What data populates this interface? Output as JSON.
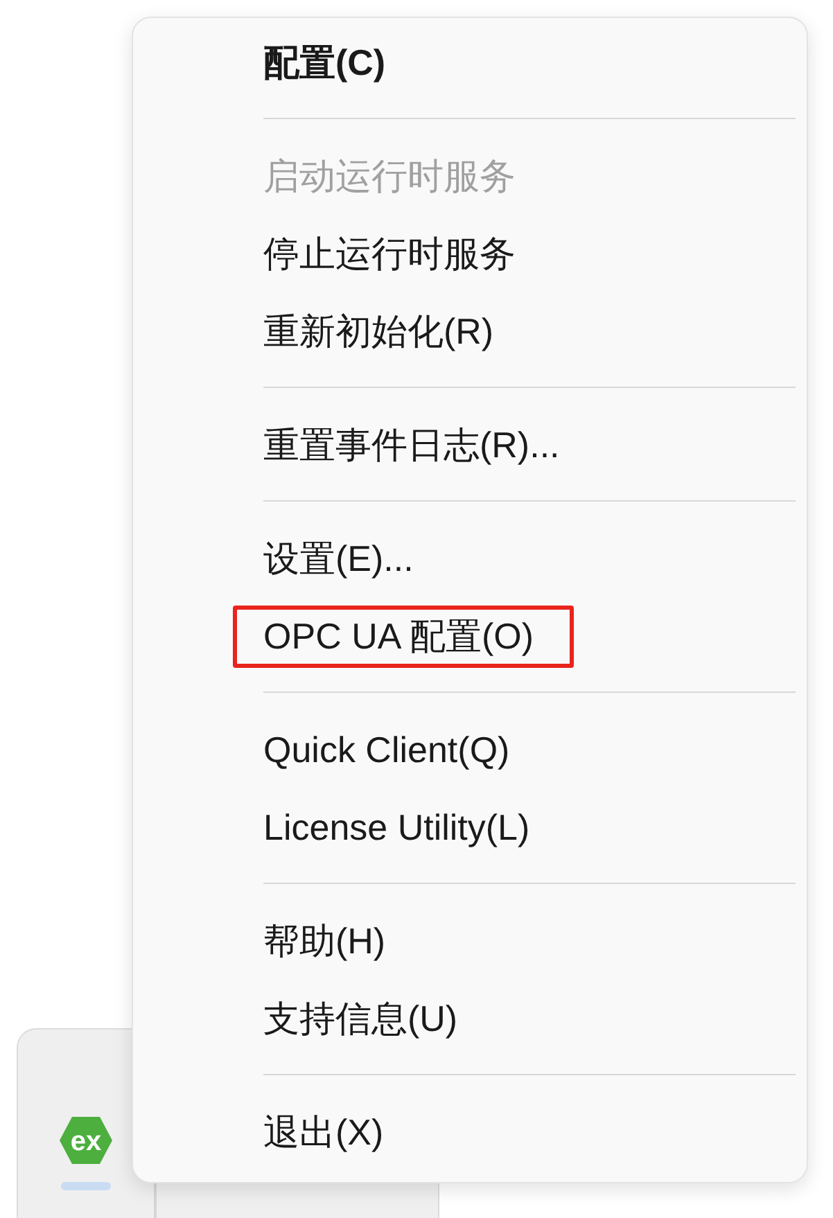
{
  "menu": {
    "groups": [
      [
        {
          "label": "配置(C)",
          "default": true,
          "disabled": false,
          "highlighted": false
        }
      ],
      [
        {
          "label": "启动运行时服务",
          "default": false,
          "disabled": true,
          "highlighted": false
        },
        {
          "label": "停止运行时服务",
          "default": false,
          "disabled": false,
          "highlighted": false
        },
        {
          "label": "重新初始化(R)",
          "default": false,
          "disabled": false,
          "highlighted": false
        }
      ],
      [
        {
          "label": "重置事件日志(R)...",
          "default": false,
          "disabled": false,
          "highlighted": false
        }
      ],
      [
        {
          "label": "设置(E)...",
          "default": false,
          "disabled": false,
          "highlighted": false
        },
        {
          "label": "OPC UA 配置(O)",
          "default": false,
          "disabled": false,
          "highlighted": true
        }
      ],
      [
        {
          "label": "Quick Client(Q)",
          "default": false,
          "disabled": false,
          "highlighted": false
        },
        {
          "label": "License Utility(L)",
          "default": false,
          "disabled": false,
          "highlighted": false
        }
      ],
      [
        {
          "label": "帮助(H)",
          "default": false,
          "disabled": false,
          "highlighted": false
        },
        {
          "label": "支持信息(U)",
          "default": false,
          "disabled": false,
          "highlighted": false
        }
      ],
      [
        {
          "label": "退出(X)",
          "default": false,
          "disabled": false,
          "highlighted": false
        }
      ]
    ]
  },
  "tray": {
    "icons": [
      {
        "label": "ex"
      }
    ]
  }
}
